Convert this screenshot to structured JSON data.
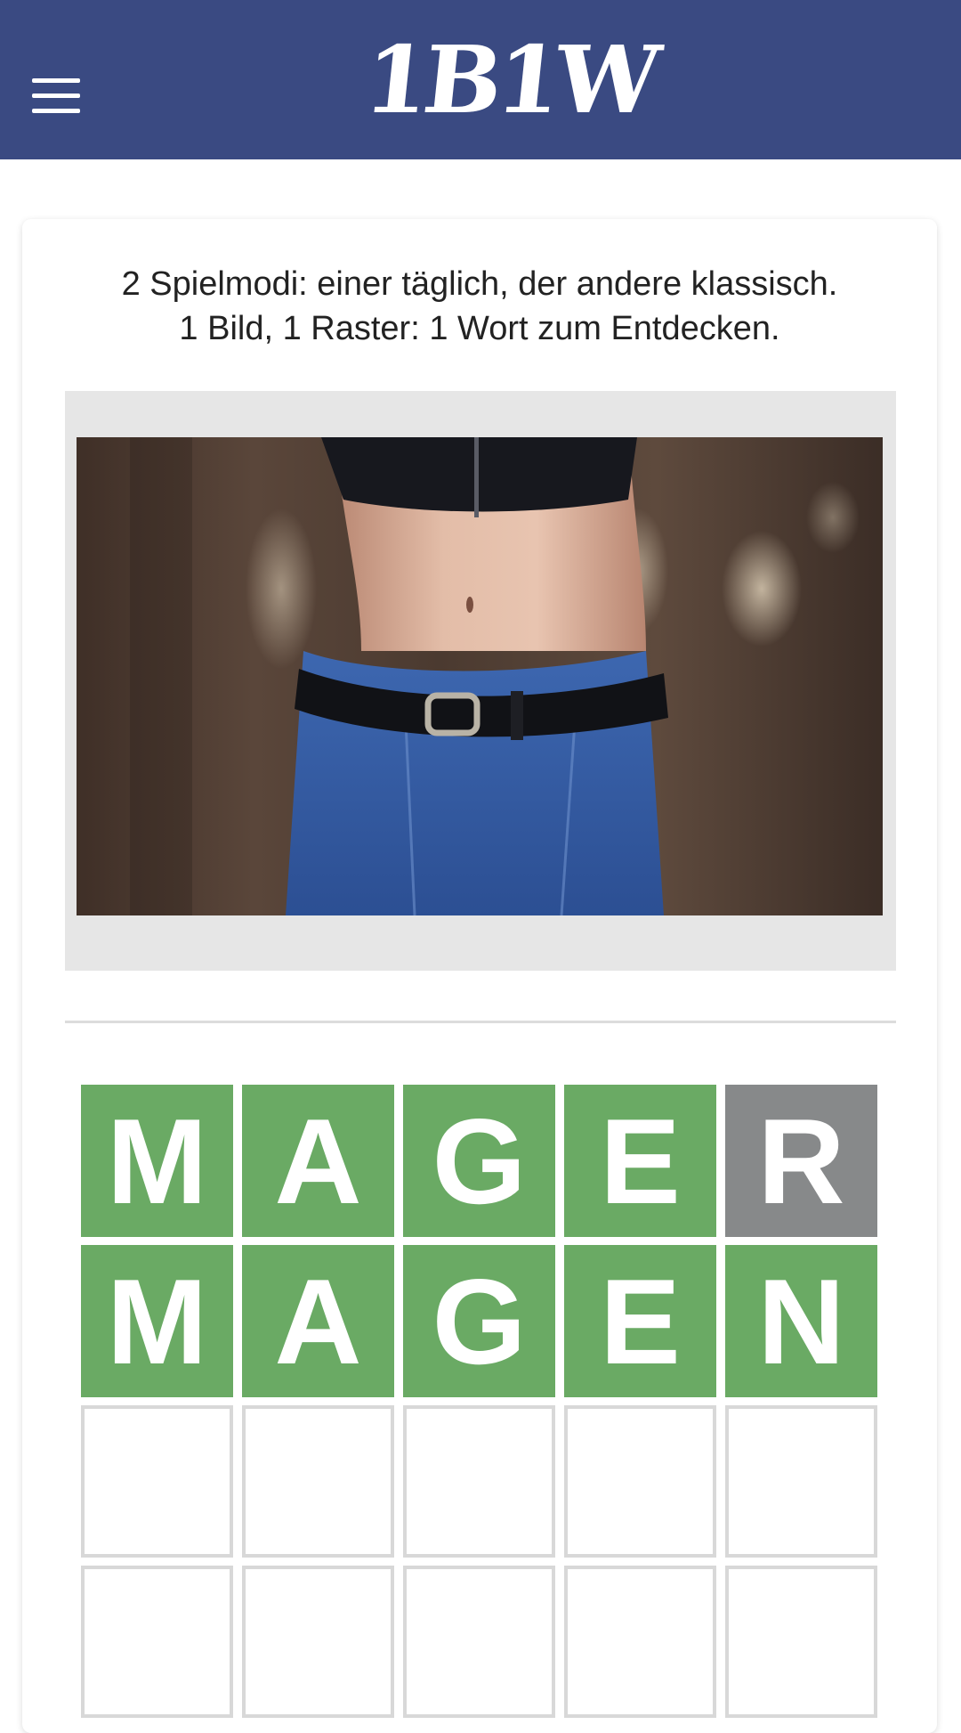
{
  "header": {
    "logo_text": "1B1W",
    "menu_icon": "hamburger-menu-icon",
    "background_color": "#3a4a82"
  },
  "intro": {
    "line1": "2 Spielmodi: einer täglich, der andere klassisch.",
    "line2": "1 Bild, 1 Raster: 1 Wort zum Entdecken."
  },
  "puzzle_image": {
    "subject": "woman's midriff, black crop top, jeans with black belt"
  },
  "grid": {
    "colors": {
      "correct": "#6aaa64",
      "absent": "#87898a",
      "empty_border": "#d8d8d8"
    },
    "rows": [
      {
        "tiles": [
          {
            "letter": "M",
            "state": "correct"
          },
          {
            "letter": "A",
            "state": "correct"
          },
          {
            "letter": "G",
            "state": "correct"
          },
          {
            "letter": "E",
            "state": "correct"
          },
          {
            "letter": "R",
            "state": "absent"
          }
        ]
      },
      {
        "tiles": [
          {
            "letter": "M",
            "state": "correct"
          },
          {
            "letter": "A",
            "state": "correct"
          },
          {
            "letter": "G",
            "state": "correct"
          },
          {
            "letter": "E",
            "state": "correct"
          },
          {
            "letter": "N",
            "state": "correct"
          }
        ]
      },
      {
        "tiles": [
          {
            "letter": "",
            "state": "empty"
          },
          {
            "letter": "",
            "state": "empty"
          },
          {
            "letter": "",
            "state": "empty"
          },
          {
            "letter": "",
            "state": "empty"
          },
          {
            "letter": "",
            "state": "empty"
          }
        ]
      },
      {
        "tiles": [
          {
            "letter": "",
            "state": "empty"
          },
          {
            "letter": "",
            "state": "empty"
          },
          {
            "letter": "",
            "state": "empty"
          },
          {
            "letter": "",
            "state": "empty"
          },
          {
            "letter": "",
            "state": "empty"
          }
        ]
      }
    ]
  }
}
